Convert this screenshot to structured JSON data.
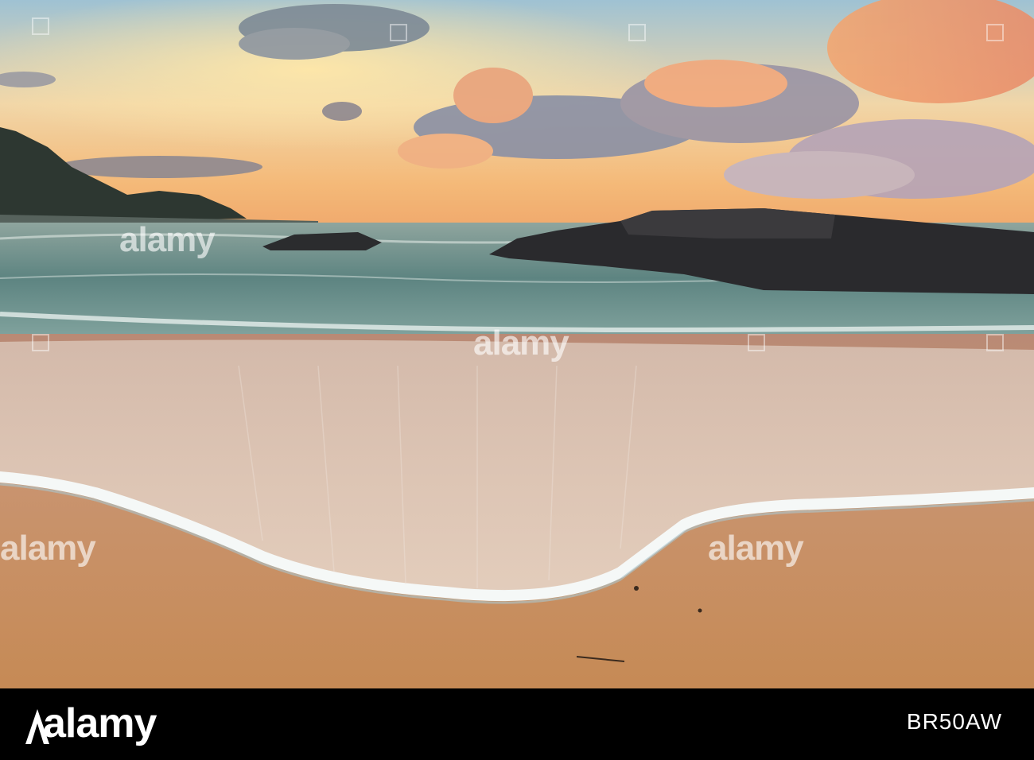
{
  "watermark": {
    "text": "alamy",
    "color": "#ffffff"
  },
  "footer": {
    "brand": "alamy",
    "image_code": "BR50AW",
    "background": "#000000"
  },
  "scene": {
    "subject": "beach at sunset with wave wash and lava rocks",
    "sky_colors": [
      "#9fc4d6",
      "#f3c98e",
      "#f5a86a"
    ],
    "sea_color": "#5f8a86",
    "sand_color": "#c98f5e",
    "foam_color": "#f4f7f6"
  }
}
